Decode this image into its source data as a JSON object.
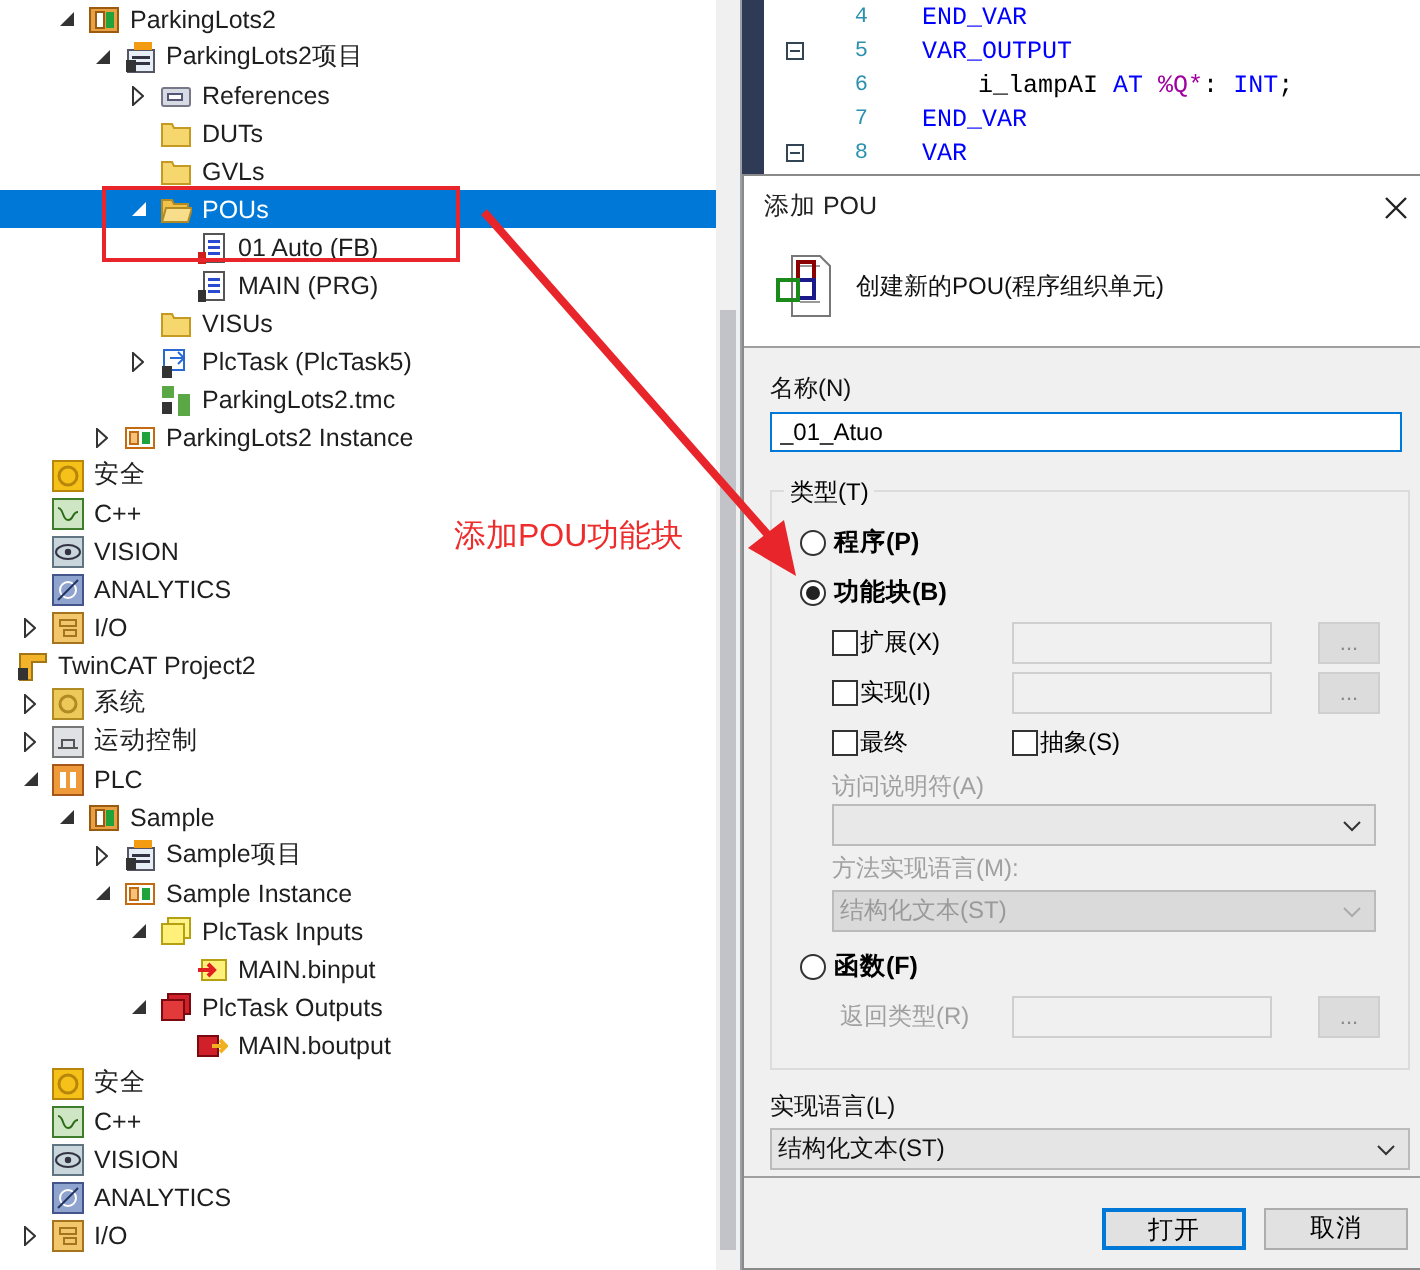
{
  "tree": [
    {
      "children": [
        {
          "children": [
            {
              "label": "ParkingLots2",
              "kind": "plc-project",
              "expanded": true,
              "selected": false,
              "children": [
                {
                  "label": "ParkingLots2项目",
                  "kind": "plc-file",
                  "expanded": true,
                  "selected": false,
                  "children": [
                    {
                      "label": "References",
                      "kind": "references",
                      "expanded": false,
                      "selected": false
                    },
                    {
                      "label": "DUTs",
                      "kind": "folder",
                      "selected": false
                    },
                    {
                      "label": "GVLs",
                      "kind": "folder",
                      "selected": false
                    },
                    {
                      "label": "POUs",
                      "kind": "folder-open",
                      "expanded": true,
                      "selected": true,
                      "children": [
                        {
                          "label": "01 Auto (FB)",
                          "kind": "pou-fb",
                          "selected": false
                        },
                        {
                          "label": "MAIN (PRG)",
                          "kind": "pou-prg",
                          "selected": false
                        }
                      ]
                    },
                    {
                      "label": "VISUs",
                      "kind": "folder",
                      "selected": false
                    },
                    {
                      "label": "PlcTask (PlcTask5)",
                      "kind": "task",
                      "expanded": false,
                      "selected": false
                    },
                    {
                      "label": "ParkingLots2.tmc",
                      "kind": "tmc",
                      "selected": false
                    }
                  ]
                },
                {
                  "label": "ParkingLots2 Instance",
                  "kind": "instance",
                  "expanded": false,
                  "selected": false
                }
              ]
            }
          ]
        },
        {
          "label": "安全",
          "kind": "safety",
          "selected": false
        },
        {
          "label": "C++",
          "kind": "cpp",
          "selected": false
        },
        {
          "label": "VISION",
          "kind": "vision",
          "selected": false
        },
        {
          "label": "ANALYTICS",
          "kind": "analytics",
          "selected": false
        },
        {
          "label": "I/O",
          "kind": "io",
          "expanded": false,
          "selected": false
        }
      ]
    },
    {
      "label": "TwinCAT Project2",
      "kind": "twincat",
      "selected": false,
      "children": [
        {
          "label": "系统",
          "kind": "system",
          "expanded": false,
          "selected": false
        },
        {
          "label": "运动控制",
          "kind": "motion",
          "expanded": false,
          "selected": false
        },
        {
          "label": "PLC",
          "kind": "plc",
          "expanded": true,
          "selected": false,
          "children": [
            {
              "label": "Sample",
              "kind": "plc-project",
              "expanded": true,
              "selected": false,
              "children": [
                {
                  "label": "Sample项目",
                  "kind": "plc-file",
                  "expanded": false,
                  "selected": false
                },
                {
                  "label": "Sample Instance",
                  "kind": "instance",
                  "expanded": true,
                  "selected": false,
                  "children": [
                    {
                      "label": "PlcTask Inputs",
                      "kind": "inputs",
                      "expanded": true,
                      "selected": false,
                      "children": [
                        {
                          "label": "MAIN.binput",
                          "kind": "input-var",
                          "selected": false
                        }
                      ]
                    },
                    {
                      "label": "PlcTask Outputs",
                      "kind": "outputs",
                      "expanded": true,
                      "selected": false,
                      "children": [
                        {
                          "label": "MAIN.boutput",
                          "kind": "output-var",
                          "selected": false
                        }
                      ]
                    }
                  ]
                }
              ]
            }
          ]
        },
        {
          "label": "安全",
          "kind": "safety",
          "selected": false
        },
        {
          "label": "C++",
          "kind": "cpp",
          "selected": false
        },
        {
          "label": "VISION",
          "kind": "vision",
          "selected": false
        },
        {
          "label": "ANALYTICS",
          "kind": "analytics",
          "selected": false
        },
        {
          "label": "I/O",
          "kind": "io",
          "expanded": false,
          "selected": false
        }
      ]
    }
  ],
  "annotation": {
    "text": "添加POU功能块"
  },
  "code": [
    {
      "number": "4",
      "fold": false,
      "kind": "block",
      "tokens": [
        {
          "text": "END_VAR",
          "kind": "keyword"
        }
      ]
    },
    {
      "number": "5",
      "fold": true,
      "kind": "block",
      "tokens": [
        {
          "text": "VAR_OUTPUT",
          "kind": "keyword"
        }
      ]
    },
    {
      "number": "6",
      "fold": false,
      "kind": "declaration",
      "tokens": [
        {
          "text": "i_lampAI ",
          "kind": "ident"
        },
        {
          "text": "AT ",
          "kind": "keyword"
        },
        {
          "text": "%Q*",
          "kind": "address"
        },
        {
          "text": ": ",
          "kind": "ident"
        },
        {
          "text": "INT",
          "kind": "keyword"
        },
        {
          "text": ";",
          "kind": "ident"
        }
      ]
    },
    {
      "number": "7",
      "fold": false,
      "kind": "block",
      "tokens": [
        {
          "text": "END_VAR",
          "kind": "keyword"
        }
      ]
    },
    {
      "number": "8",
      "fold": true,
      "kind": "block",
      "tokens": [
        {
          "text": "VAR",
          "kind": "keyword"
        }
      ]
    }
  ],
  "dialog": {
    "title": "添加 POU",
    "header": "创建新的POU(程序组织单元)",
    "name": {
      "label": "名称(N)",
      "value": "_01_Atuo"
    },
    "type_group": {
      "label": "类型(T)",
      "program": {
        "label": "程序(P)",
        "selected": false
      },
      "function_block": {
        "label": "功能块(B)",
        "selected": true,
        "extends": {
          "label": "扩展(X)",
          "checked": false,
          "button": "..."
        },
        "implements": {
          "label": "实现(I)",
          "checked": false,
          "button": "..."
        },
        "final": {
          "label": "最终",
          "checked": false
        },
        "abstract": {
          "label": "抽象(S)",
          "checked": false
        },
        "access_specifier": {
          "label": "访问说明符(A)",
          "disabled": true
        },
        "method_language": {
          "label": "方法实现语言(M):",
          "value": "结构化文本(ST)",
          "disabled": true
        }
      },
      "function": {
        "label": "函数(F)",
        "selected": false,
        "return_type": {
          "label": "返回类型(R)",
          "disabled": true,
          "button": "..."
        }
      }
    },
    "language": {
      "label": "实现语言(L)",
      "value": "结构化文本(ST)"
    },
    "buttons": [
      {
        "label": "打开",
        "default": true
      },
      {
        "label": "取消",
        "default": false
      }
    ]
  }
}
